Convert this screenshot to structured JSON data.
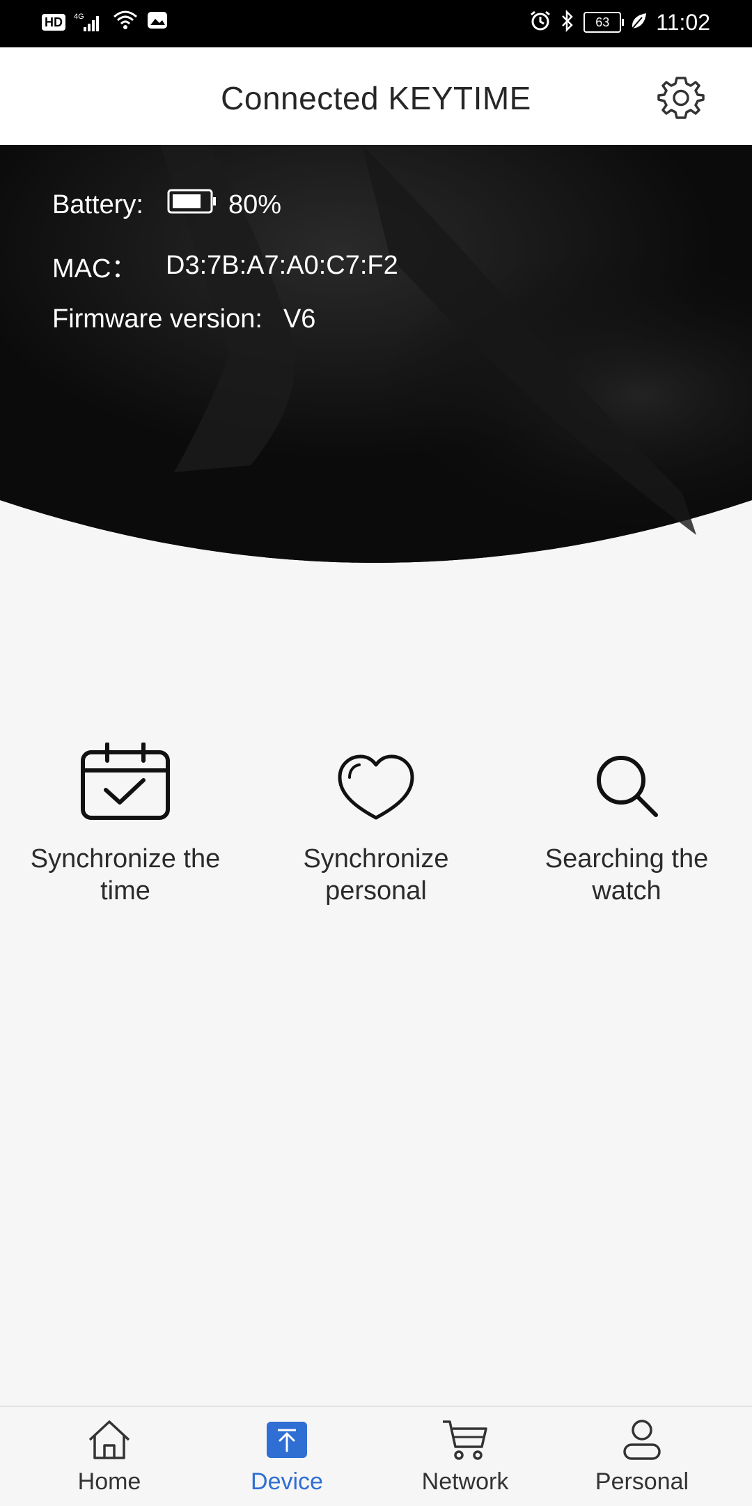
{
  "status_bar": {
    "hd": "HD",
    "network": "4G",
    "battery": "63",
    "time": "11:02"
  },
  "header": {
    "title": "Connected KEYTIME"
  },
  "device_info": {
    "battery_label": "Battery:",
    "battery_value": "80%",
    "battery_level": 0.8,
    "mac_label": "MAC：",
    "mac_value": "D3:7B:A7:A0:C7:F2",
    "firmware_label": "Firmware version:",
    "firmware_value": "V6"
  },
  "actions": [
    {
      "label": "Synchronize the time",
      "icon": "calendar-check-icon"
    },
    {
      "label": "Synchronize personal",
      "icon": "heart-icon"
    },
    {
      "label": "Searching the watch",
      "icon": "search-icon"
    }
  ],
  "bottom_nav": [
    {
      "label": "Home",
      "icon": "home-icon"
    },
    {
      "label": "Device",
      "icon": "device-upload-icon",
      "active": true
    },
    {
      "label": "Network",
      "icon": "cart-icon"
    },
    {
      "label": "Personal",
      "icon": "person-icon"
    }
  ],
  "colors": {
    "accent": "#2f6ed2",
    "hero_bg": "#0b0b0b",
    "page_bg": "#f6f6f6"
  }
}
